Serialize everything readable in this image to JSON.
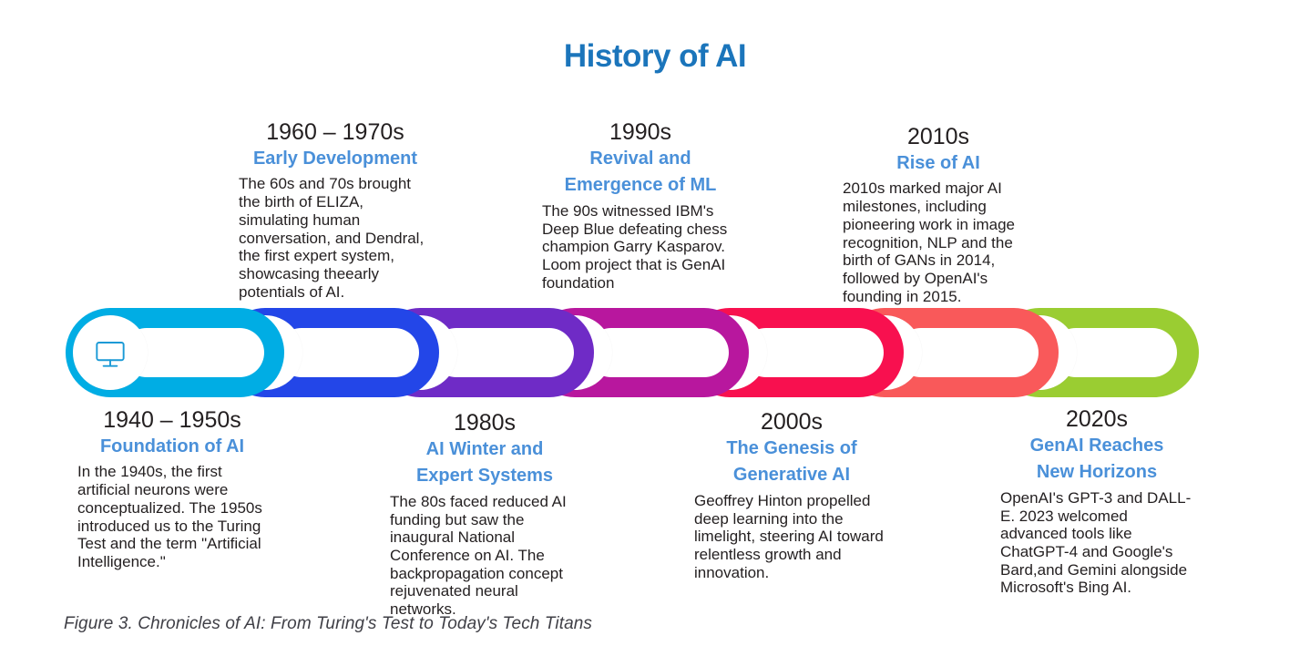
{
  "title": "History of AI",
  "caption": "Figure 3. Chronicles of AI: From Turing's Test to Today's Tech Titans",
  "theme": {
    "title_color": "#1b75bb",
    "subtitle_color": "#4a90d9",
    "body_color": "#231f20",
    "caption_color": "#3f3f46",
    "background": "#ffffff"
  },
  "timeline": {
    "segments": [
      {
        "id": "seg-1",
        "color": "#00ade4",
        "icon": "monitor-icon",
        "icon_color": "#1b9ad6",
        "era": "1940 – 1950s"
      },
      {
        "id": "seg-2",
        "color": "#2346e8",
        "icon": "microphone-icon",
        "icon_color": "#2346e8",
        "era": "1960 – 1970s"
      },
      {
        "id": "seg-3",
        "color": "#6f2bc6",
        "icon": "video-camera-icon",
        "icon_color": "#6f2bc6",
        "era": "1980s"
      },
      {
        "id": "seg-4",
        "color": "#b8179e",
        "icon": "smartphone-chat-icon",
        "icon_color": "#b8179e",
        "era": "1990s"
      },
      {
        "id": "seg-5",
        "color": "#f8104f",
        "icon": "server-database-icon",
        "icon_color": "#e5175a",
        "era": "2000s"
      },
      {
        "id": "seg-6",
        "color": "#f9595a",
        "icon": "floppy-disk-icon",
        "icon_color": "#f0564f",
        "era": "2010s"
      },
      {
        "id": "seg-7",
        "color": "#9acd32",
        "icon": "gear-icon",
        "icon_color": "#2a84b5",
        "era": "2020s"
      }
    ]
  },
  "entries": {
    "foundation": {
      "year": "1940 – 1950s",
      "subtitle": "Foundation of AI",
      "body": "In the 1940s, the first artificial neurons were conceptualized. The 1950s introduced us to the Turing Test and the term \"Artificial Intelligence.\""
    },
    "early_development": {
      "year": "1960 – 1970s",
      "subtitle": "Early Development",
      "body": "The 60s and 70s brought the birth of ELIZA, simulating human conversation, and Dendral, the first expert system, showcasing theearly potentials of AI."
    },
    "ai_winter": {
      "year": "1980s",
      "subtitle_line1": "AI Winter and",
      "subtitle_line2": "Expert Systems",
      "body": "The 80s faced reduced AI funding but saw the inaugural National Conference on AI. The backpropagation concept rejuvenated neural networks."
    },
    "revival": {
      "year": "1990s",
      "subtitle_line1": "Revival and",
      "subtitle_line2": "Emergence of ML",
      "body": "The 90s witnessed IBM's Deep Blue defeating chess champion Garry Kasparov. Loom project that is GenAI foundation"
    },
    "genesis": {
      "year": "2000s",
      "subtitle_line1": "The Genesis of",
      "subtitle_line2": "Generative AI",
      "body": "Geoffrey Hinton propelled deep learning into the limelight, steering AI toward relentless growth and innovation."
    },
    "rise": {
      "year": "2010s",
      "subtitle": "Rise of AI",
      "body": "2010s marked major AI milestones, including pioneering work in image recognition, NLP and the birth of GANs in 2014, followed by OpenAI's founding in 2015."
    },
    "genai": {
      "year": "2020s",
      "subtitle_line1": "GenAI Reaches",
      "subtitle_line2": "New Horizons",
      "body": "OpenAI's GPT-3 and DALL-E. 2023 welcomed advanced tools like ChatGPT-4 and Google's Bard,and Gemini alongside Microsoft's Bing AI."
    }
  }
}
